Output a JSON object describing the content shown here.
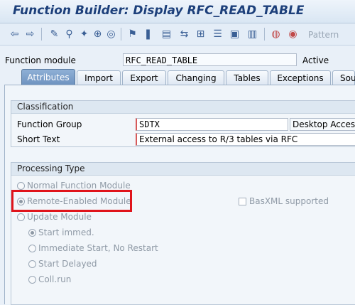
{
  "window": {
    "title": "Function Builder: Display RFC_READ_TABLE"
  },
  "toolbar": {
    "icons": [
      "back-arrow-icon",
      "forward-arrow-icon",
      "toggle-display-change-icon",
      "check-icon",
      "activate-icon",
      "where-used-icon",
      "object-list-icon",
      "navigation-icon",
      "display-object-list-icon",
      "inactive-objects-icon",
      "help-icon",
      "other-object-icon",
      "test-icon",
      "breakpoint-icon",
      "pattern-icon"
    ],
    "pattern_label": "Pattern"
  },
  "function_module": {
    "label": "Function module",
    "value": "RFC_READ_TABLE",
    "status": "Active"
  },
  "tabs": [
    "Attributes",
    "Import",
    "Export",
    "Changing",
    "Tables",
    "Exceptions",
    "Sou"
  ],
  "classification": {
    "title": "Classification",
    "function_group_label": "Function Group",
    "function_group_value": "SDTX",
    "function_group_text": "Desktop Access",
    "short_text_label": "Short Text",
    "short_text_value": "External access to R/3 tables via RFC"
  },
  "processing_type": {
    "title": "Processing Type",
    "options": [
      "Normal Function Module",
      "Remote-Enabled Module",
      "Update Module"
    ],
    "selected": "Remote-Enabled Module",
    "basxml_label": "BasXML supported",
    "update_options": [
      "Start immed.",
      "Immediate Start, No Restart",
      "Start Delayed",
      "Coll.run"
    ],
    "update_selected": "Start immed."
  },
  "colors": {
    "accent": "#1c3f7a",
    "highlight_box": "#e0141b",
    "active_tab": "#6f93c0"
  }
}
